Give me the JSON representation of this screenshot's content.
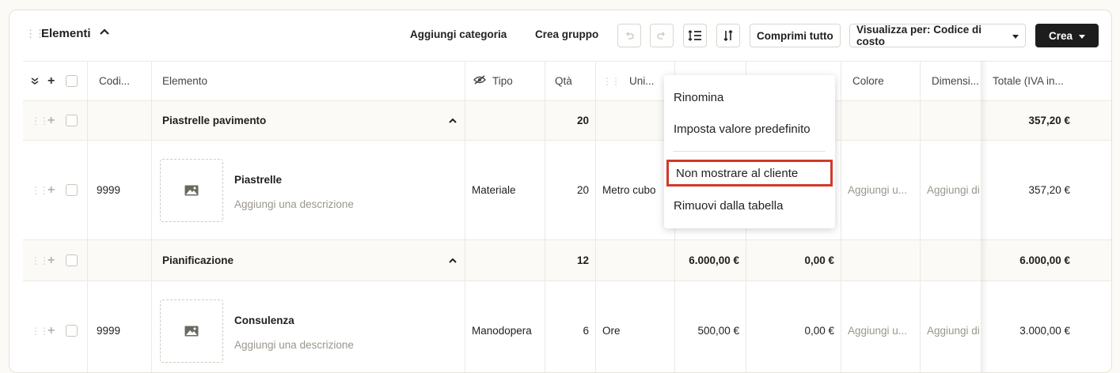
{
  "toolbar": {
    "title": "Elementi",
    "add_category": "Aggiungi categoria",
    "create_group": "Crea gruppo",
    "collapse_all": "Comprimi tutto",
    "view_by": "Visualizza per: Codice di costo",
    "create": "Crea"
  },
  "columns": {
    "code": "Codi...",
    "element": "Elemento",
    "type": "Tipo",
    "qty": "Qtà",
    "unit": "Uni...",
    "color": "Colore",
    "dimensions": "Dimensi...",
    "total": "Totale (IVA in..."
  },
  "rows": {
    "group1": {
      "name": "Piastrelle pavimento",
      "qty": "20",
      "total": "357,20 €"
    },
    "item1": {
      "code": "9999",
      "name": "Piastrelle",
      "desc_placeholder": "Aggiungi una descrizione",
      "type": "Materiale",
      "qty": "20",
      "unit": "Metro cubo",
      "color": "Aggiungi u...",
      "dimensions": "Aggiungi di",
      "total": "357,20 €"
    },
    "group2": {
      "name": "Pianificazione",
      "qty": "12",
      "price": "6.000,00 €",
      "cost": "0,00 €",
      "total": "6.000,00 €"
    },
    "item2": {
      "code": "9999",
      "name": "Consulenza",
      "desc_placeholder": "Aggiungi una descrizione",
      "type": "Manodopera",
      "qty": "6",
      "unit": "Ore",
      "price": "500,00 €",
      "cost": "0,00 €",
      "color": "Aggiungi u...",
      "dimensions": "Aggiungi di",
      "total": "3.000,00 €"
    }
  },
  "menu": {
    "rename": "Rinomina",
    "set_default": "Imposta valore predefinito",
    "hide_from_client": "Non mostrare al cliente",
    "remove_from_table": "Rimuovi dalla tabella"
  },
  "colors": {
    "accent_dark": "#1d1d1d",
    "highlight": "#d23a2a"
  }
}
